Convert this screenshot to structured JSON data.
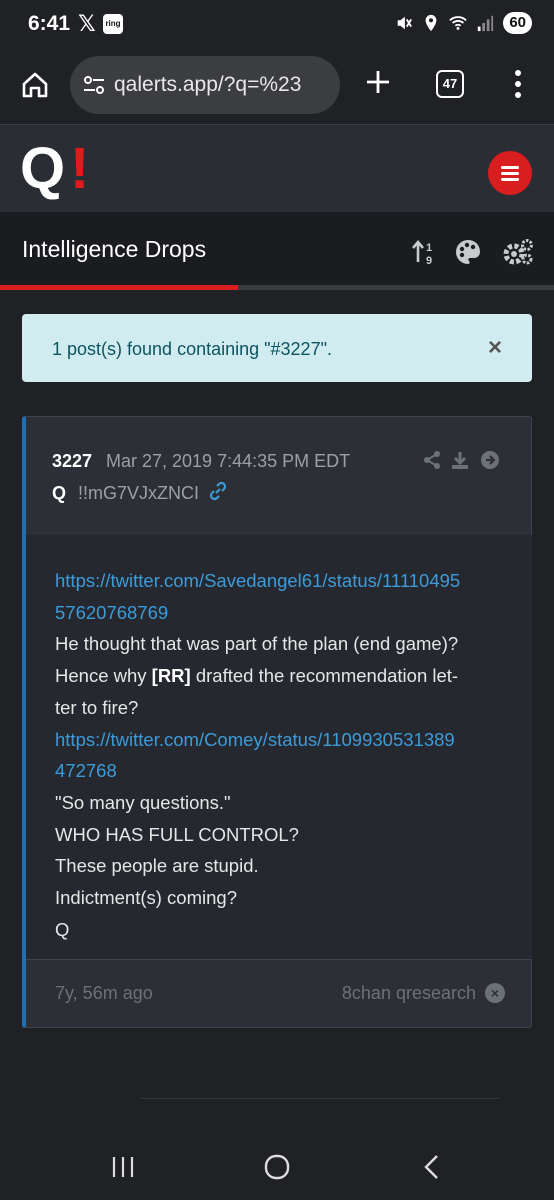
{
  "status_bar": {
    "time": "6:41",
    "x_app": "𝕏",
    "ring_app": "ring",
    "battery": "60",
    "icons": [
      "mute-icon",
      "location-icon",
      "wifi-icon",
      "signal-icon"
    ]
  },
  "browser": {
    "url": "qalerts.app/?q=%23",
    "tab_count": "47",
    "icons": [
      "home-icon",
      "site-settings-icon",
      "new-tab-icon",
      "tabs-icon",
      "more-vert-icon"
    ]
  },
  "site": {
    "logo_q": "Q",
    "logo_ex": "!",
    "accent": "#d81e1e"
  },
  "title_bar": {
    "title": "Intelligence Drops",
    "progress": 0.43,
    "icons": [
      "sort-numeric-icon",
      "palette-icon",
      "settings-cogs-icon"
    ]
  },
  "alert": {
    "text": "1 post(s) found containing \"#3227\".",
    "close": "×"
  },
  "post": {
    "number": "3227",
    "date": "Mar 27, 2019 7:44:35 PM EDT",
    "author": "Q",
    "tripcode": "!!mG7VJxZNCI",
    "lines": {
      "link1_a": "https://twitter.com/Savedangel61/status/11110495",
      "link1_b": "57620768769",
      "l1": "He thought that was part of the plan (end game)?",
      "l2_pre": "Hence why ",
      "l2_bold": "[RR]",
      "l2_post": " drafted the recommendation let-",
      "l3": "ter to fire?",
      "link2_a": "https://twitter.com/Comey/status/1109930531389",
      "link2_b": "472768",
      "l4": "\"So many questions.\"",
      "l5": "WHO HAS FULL CONTROL?",
      "l6": "These people are stupid.",
      "l7": "Indictment(s) coming?",
      "l8": "Q"
    },
    "age": "7y, 56m ago",
    "source": "8chan qresearch",
    "close": "×"
  }
}
